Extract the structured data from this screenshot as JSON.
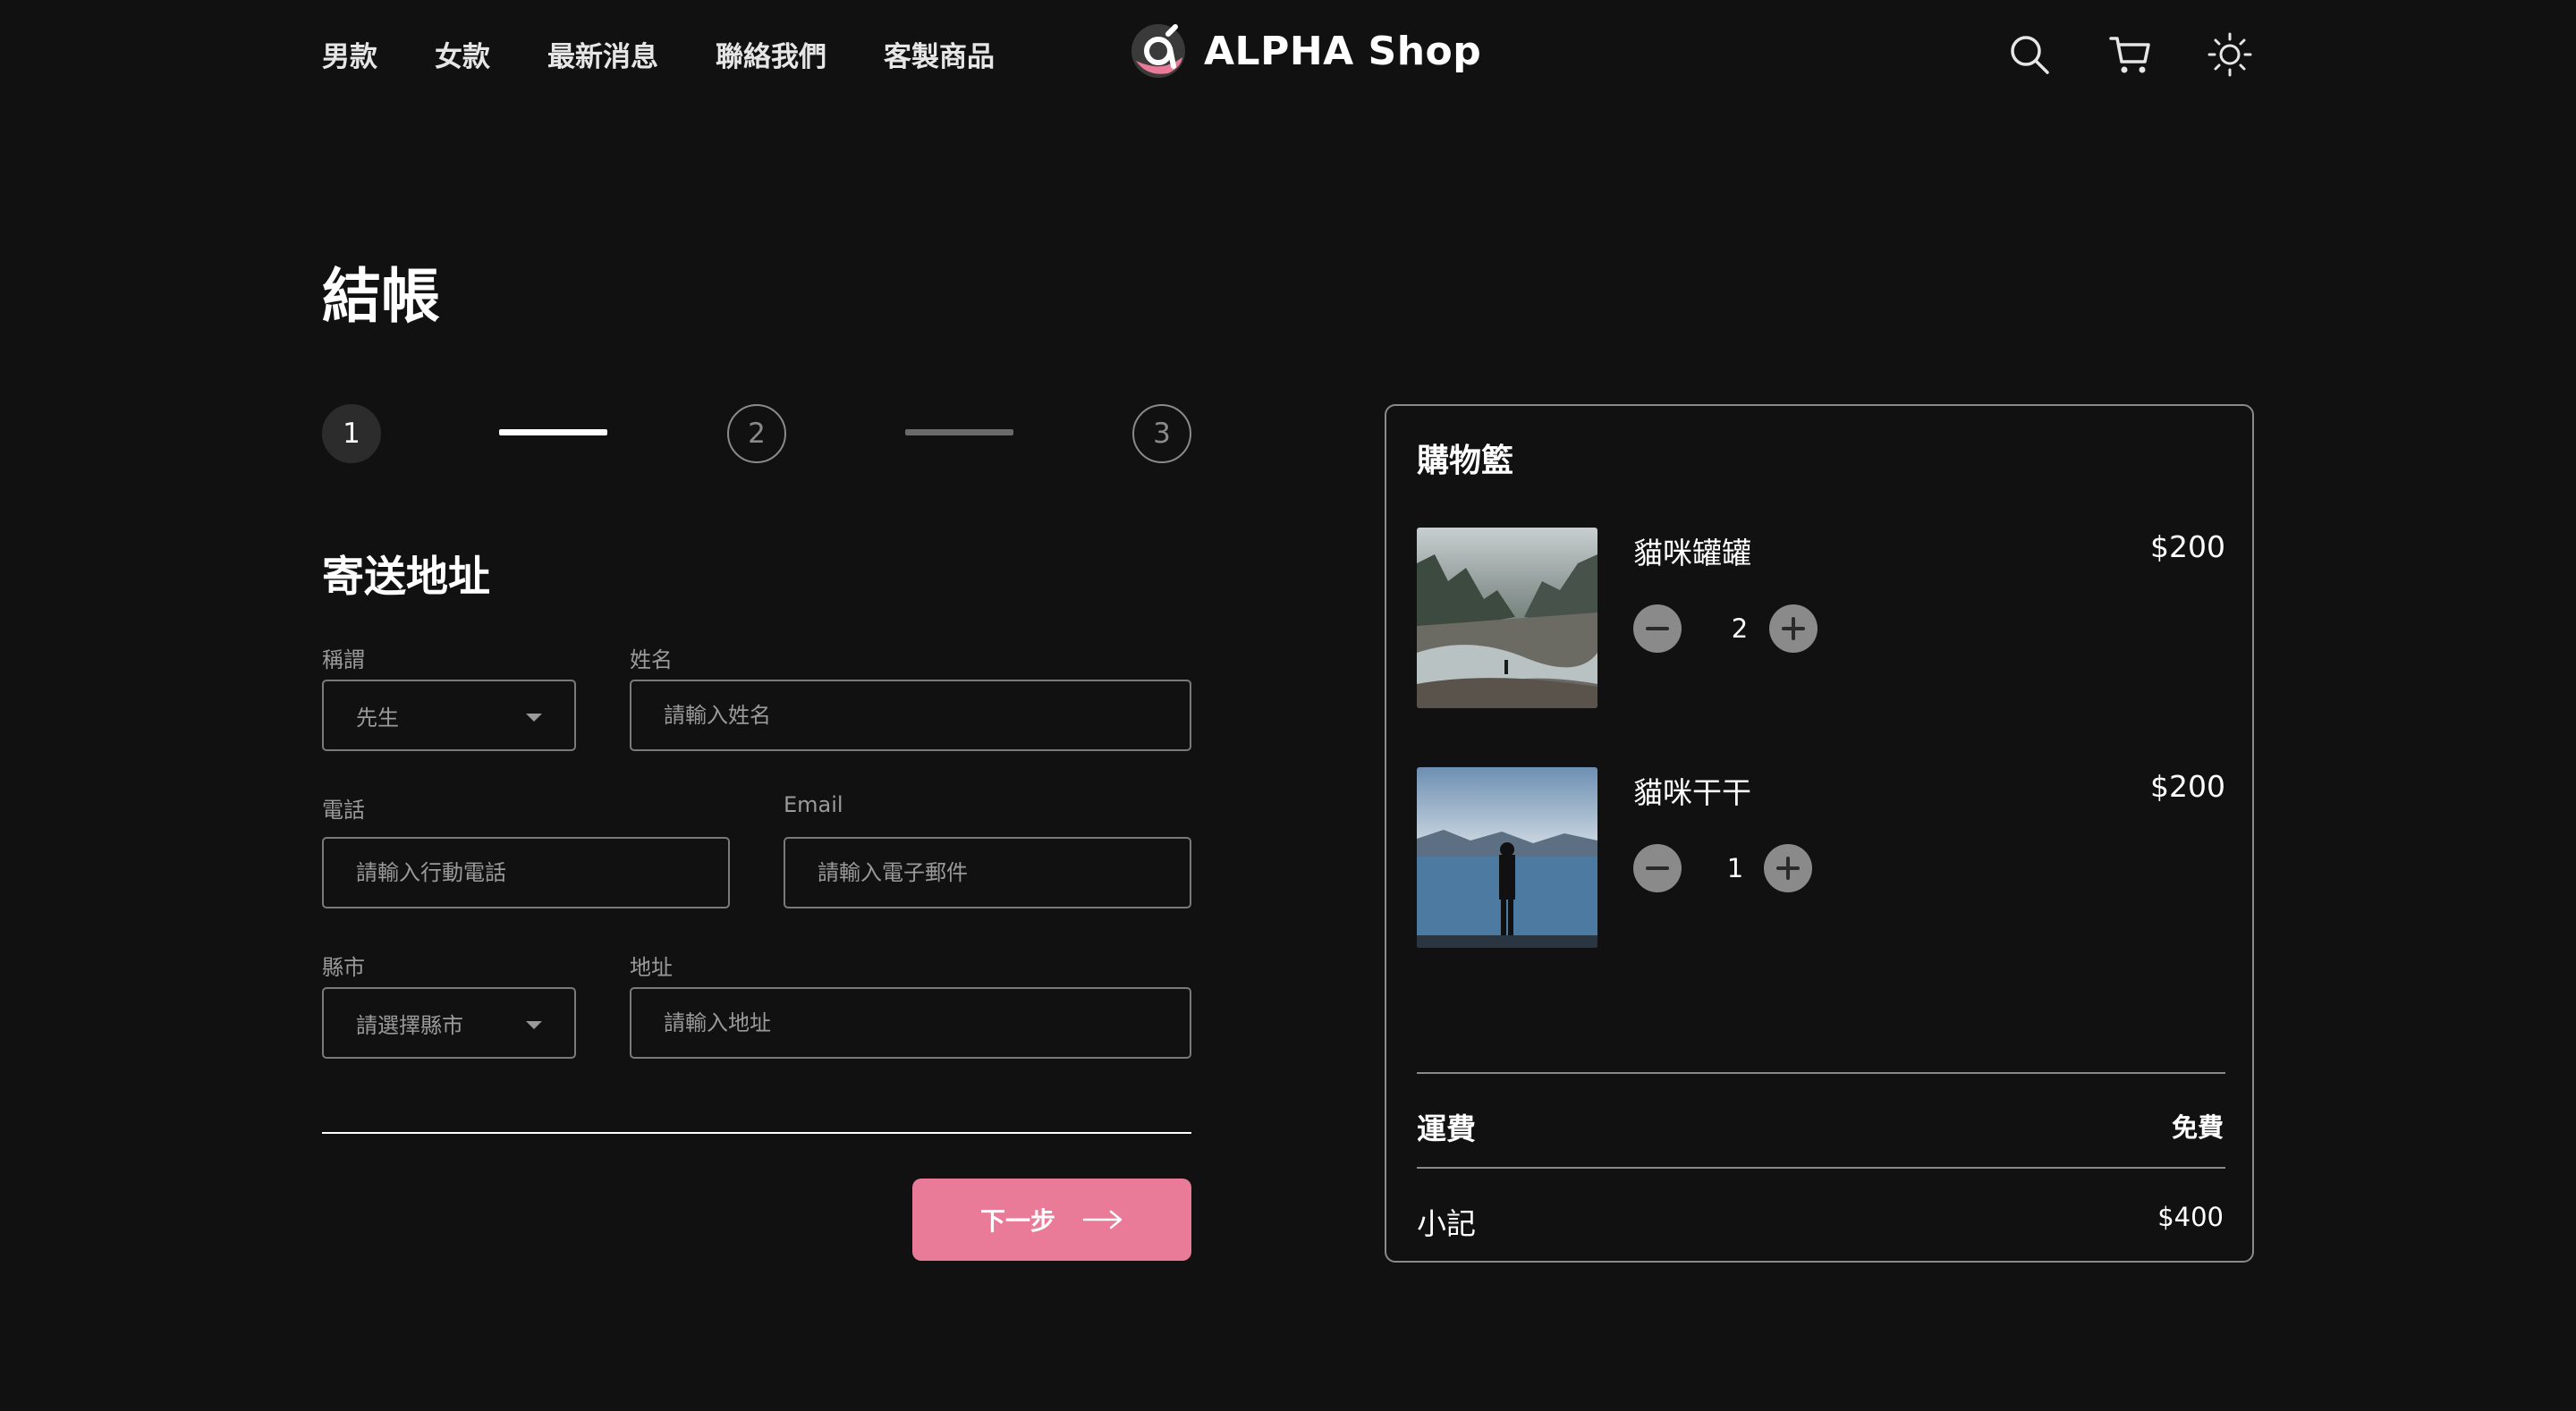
{
  "nav": {
    "links": [
      "男款",
      "女款",
      "最新消息",
      "聯絡我們",
      "客製商品"
    ],
    "brand": "ALPHA Shop",
    "icons": [
      "search-icon",
      "cart-icon",
      "sun-icon"
    ]
  },
  "page_title": "結帳",
  "stepper": {
    "steps": [
      "1",
      "2",
      "3"
    ],
    "active_step": 1
  },
  "form": {
    "section_title": "寄送地址",
    "salutation": {
      "label": "稱謂",
      "value": "先生"
    },
    "name": {
      "label": "姓名",
      "placeholder": "請輸入姓名"
    },
    "phone": {
      "label": "電話",
      "placeholder": "請輸入行動電話"
    },
    "email": {
      "label": "Email",
      "placeholder": "請輸入電子郵件"
    },
    "city": {
      "label": "縣市",
      "value": "請選擇縣市"
    },
    "address": {
      "label": "地址",
      "placeholder": "請輸入地址"
    },
    "next_label": "下一步"
  },
  "cart": {
    "title": "購物籃",
    "items": [
      {
        "name": "貓咪罐罐",
        "price": "$200",
        "quantity": "2"
      },
      {
        "name": "貓咪干干",
        "price": "$200",
        "quantity": "1"
      }
    ],
    "shipping_label": "運費",
    "shipping_value": "免費",
    "subtotal_label": "小記",
    "subtotal_value": "$400"
  },
  "colors": {
    "background": "#111111",
    "accent": "#e97a98",
    "border": "#8a8a8a"
  }
}
